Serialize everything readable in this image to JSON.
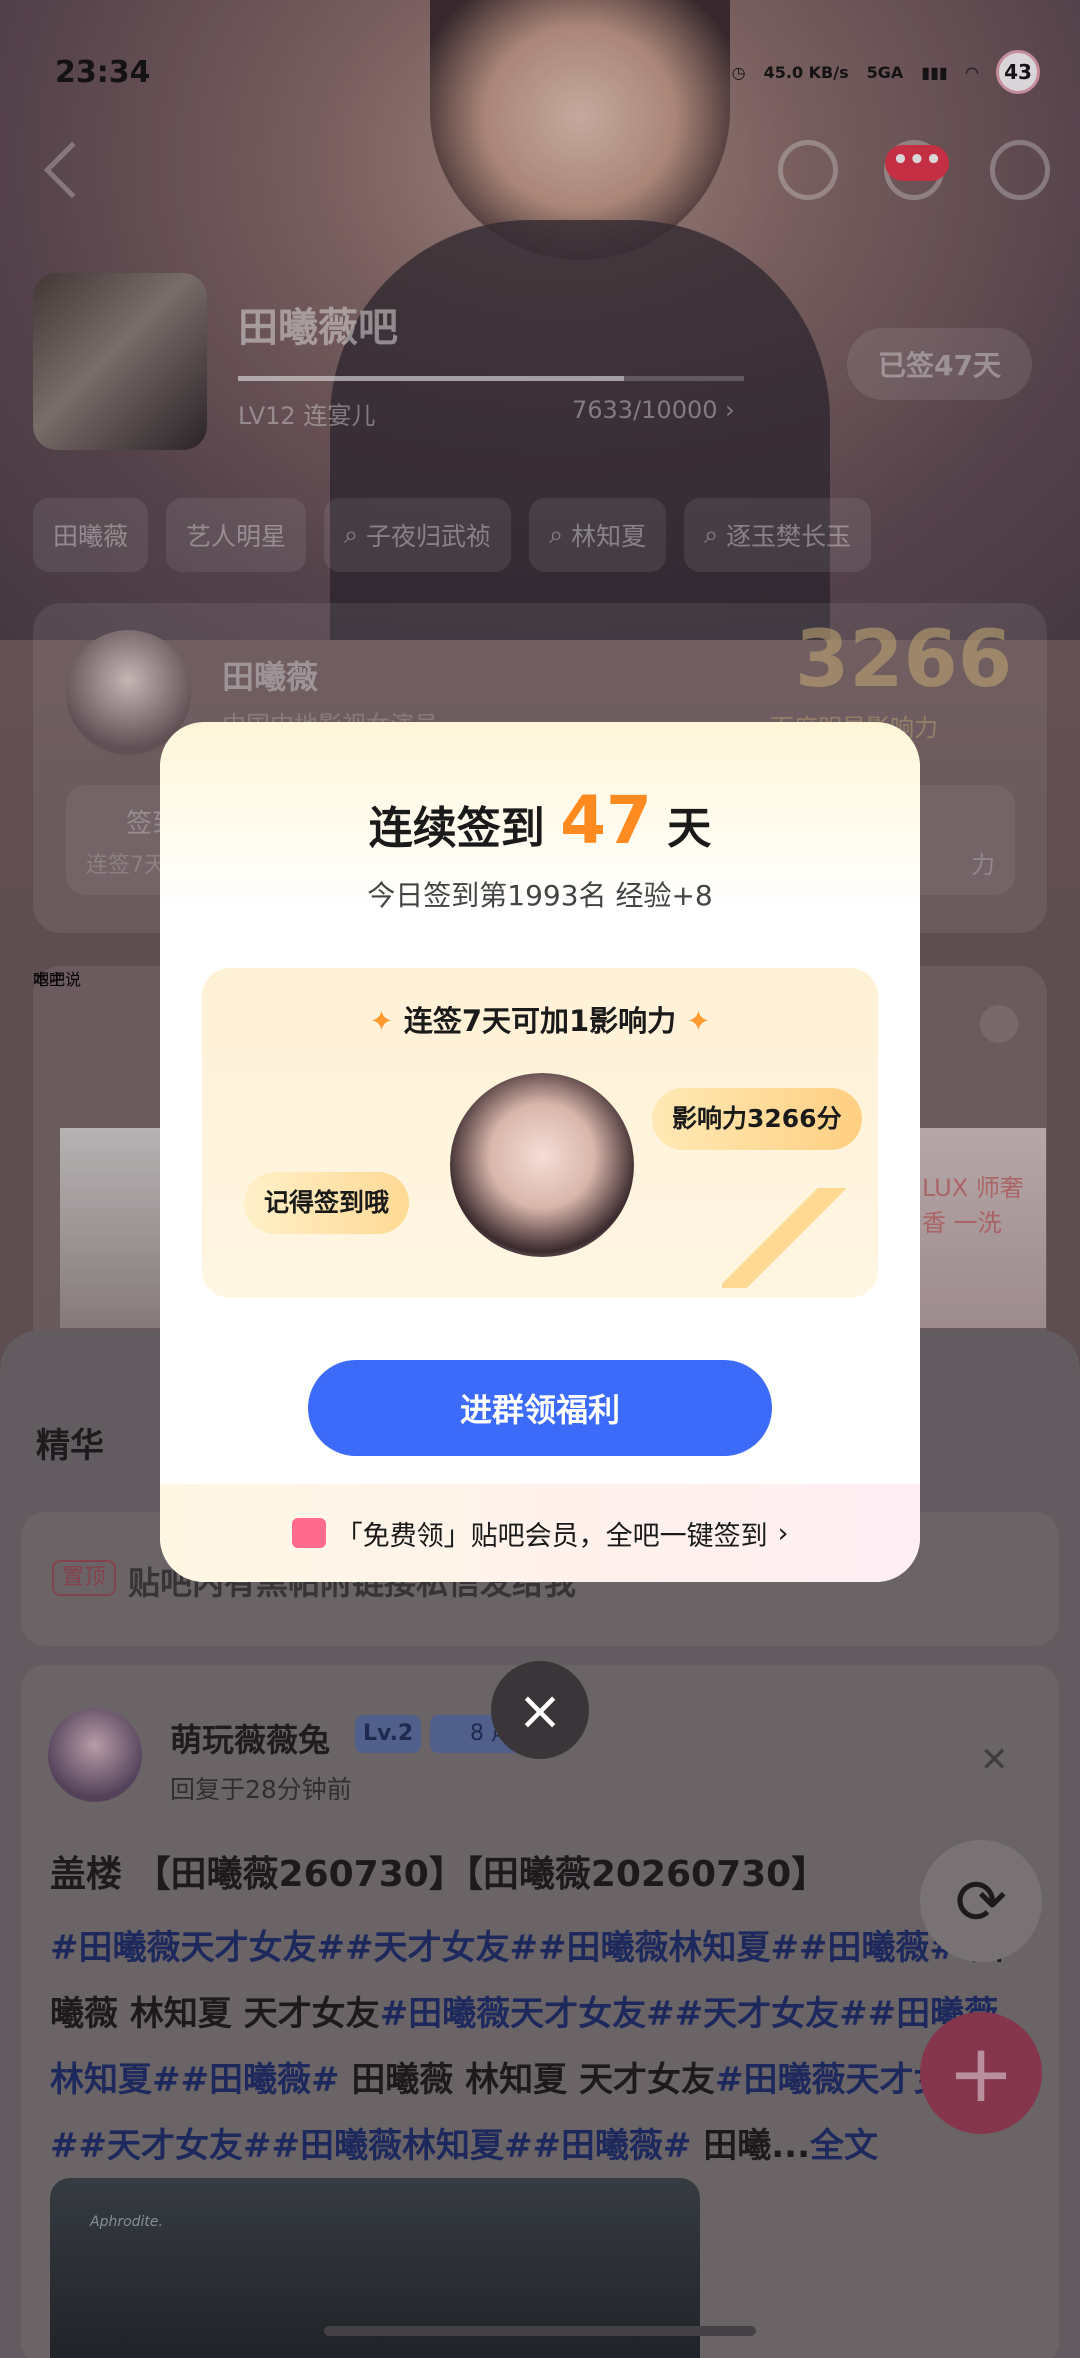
{
  "status_bar": {
    "time": "23:34",
    "net_speed": "45.0 KB/s",
    "network": "5GA",
    "battery": "43"
  },
  "header": {
    "more_badge": "•••"
  },
  "forum": {
    "name": "田曦薇吧",
    "level_text": "LV12 连宴儿",
    "exp_text": "7633/10000",
    "exp_progress": 0.7633,
    "signed_button": "已签47天"
  },
  "tags": [
    "田曦薇",
    "艺人明星",
    "子夜归武祯",
    "林知夏",
    "逐玉樊长玉"
  ],
  "star_card": {
    "name": "田曦薇",
    "subtitle": "中国内地影视女演员",
    "score": "3266",
    "score_label": "百度明星影响力",
    "signin_label": "签到",
    "signin_sub": "连签7天",
    "right_label": "力"
  },
  "promo_card": {
    "title": "本吧",
    "subtitle": "吧主说",
    "right_ad": "LUX 师奢香 一洗"
  },
  "feed": {
    "tab_best": "精华",
    "pinned_badge": "置顶",
    "pinned_text": "贴吧内有黑帖附链接私信发给我",
    "post": {
      "username": "萌玩薇薇兔",
      "level": "Lv.2",
      "badge_num": "8",
      "badge_text": "声援贴",
      "time": "回复于28分钟前",
      "title": "盖楼 【田曦薇260730】【田曦薇20260730】",
      "body_segments": [
        {
          "text": "#田曦薇天才女友##天才女友##田曦薇林知夏##田曦薇# ",
          "highlight": true
        },
        {
          "text": "田曦薇 林知夏 天才女友",
          "highlight": false
        },
        {
          "text": "#田曦薇天才女友##天才女友##田曦薇林知夏##田曦薇# ",
          "highlight": true
        },
        {
          "text": "田曦薇 林知夏 天才女友",
          "highlight": false
        },
        {
          "text": "#田曦薇天才女友##天才女友##田曦薇林知夏##田曦薇# ",
          "highlight": true
        },
        {
          "text": "田曦...",
          "highlight": false
        },
        {
          "text": "全文",
          "highlight": true
        }
      ],
      "image_caption": "Aphrodite."
    }
  },
  "modal": {
    "title_prefix": "连续签到",
    "days": "47",
    "title_suffix": "天",
    "subtitle": "今日签到第1993名 经验+8",
    "card_title": "连签7天可加1影响力",
    "bubble_right": "影响力3266分",
    "bubble_left": "记得签到哦",
    "button": "进群领福利",
    "footer": "「免费领」贴吧会员，全吧一键签到",
    "close_icon": "×"
  },
  "colors": {
    "accent_blue": "#3C6BFA",
    "accent_orange": "#FF8A1F",
    "fab_pink": "#9A3C55"
  }
}
